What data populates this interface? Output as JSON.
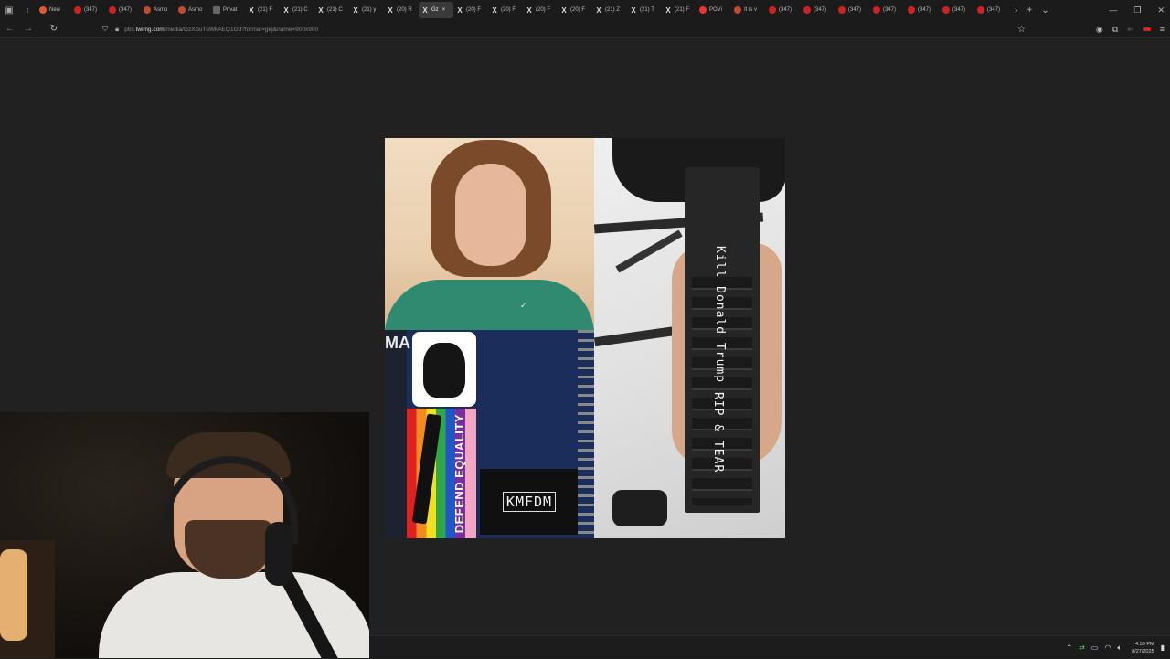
{
  "browser": {
    "tabs": [
      {
        "label": "New",
        "icon": "new-tab-icon"
      },
      {
        "label": "(347)",
        "icon": "youtube-icon"
      },
      {
        "label": "(347)",
        "icon": "youtube-icon"
      },
      {
        "label": "Asmo",
        "icon": "twitch-icon"
      },
      {
        "label": "Asmo",
        "icon": "twitch-icon"
      },
      {
        "label": "Privat",
        "icon": "private-icon"
      },
      {
        "label": "(21) F",
        "icon": "x-icon"
      },
      {
        "label": "(21) C",
        "icon": "x-icon"
      },
      {
        "label": "(21) C",
        "icon": "x-icon"
      },
      {
        "label": "(21) y",
        "icon": "x-icon"
      },
      {
        "label": "(20) R",
        "icon": "x-icon"
      },
      {
        "label": "Gz",
        "icon": "x-icon",
        "active": true
      },
      {
        "label": "(20) F",
        "icon": "x-icon"
      },
      {
        "label": "(20) F",
        "icon": "x-icon"
      },
      {
        "label": "(20) F",
        "icon": "x-icon"
      },
      {
        "label": "(20) F",
        "icon": "x-icon"
      },
      {
        "label": "(21) Z",
        "icon": "x-icon"
      },
      {
        "label": "(21) T",
        "icon": "x-icon"
      },
      {
        "label": "(21) F",
        "icon": "x-icon"
      },
      {
        "label": "POVi",
        "icon": "pov-icon"
      },
      {
        "label": "It is v",
        "icon": "twitch-icon"
      },
      {
        "label": "(347)",
        "icon": "youtube-icon"
      },
      {
        "label": "(347)",
        "icon": "youtube-icon"
      },
      {
        "label": "(347)",
        "icon": "youtube-icon"
      },
      {
        "label": "(347)",
        "icon": "youtube-icon"
      },
      {
        "label": "(347)",
        "icon": "youtube-icon"
      },
      {
        "label": "(347)",
        "icon": "youtube-icon"
      },
      {
        "label": "(347)",
        "icon": "youtube-icon"
      }
    ],
    "url": {
      "prefix": "pbs.",
      "host": "twimg.com",
      "path": "/media/GzXSuTuWkAEQ1Gd?format=jpg&name=900x900"
    }
  },
  "image": {
    "rail_text_1": "Kill Donald Trump",
    "rail_text_2": "RIP & TEAR",
    "sticker_text": "DEFEND EQUALITY",
    "sticker2_text": "KMFDM",
    "ma_text": "MA"
  },
  "taskbar": {
    "time": "4:58 PM",
    "date": "8/27/2025"
  }
}
